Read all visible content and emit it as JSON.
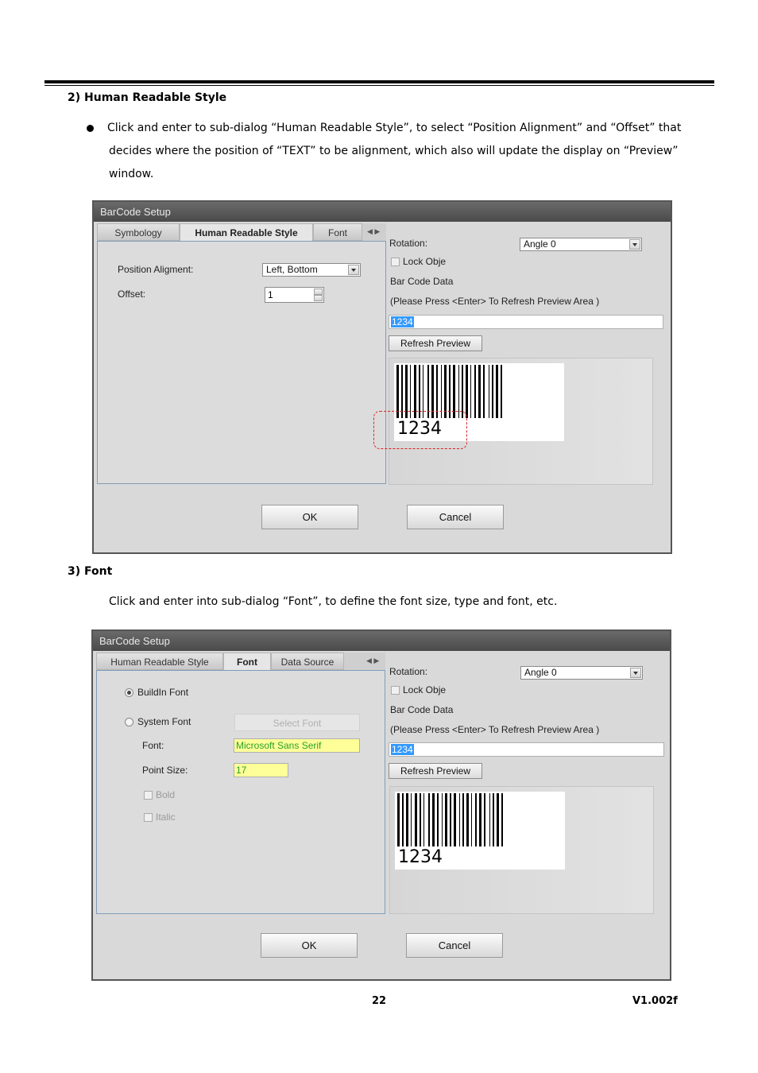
{
  "section2": {
    "heading": "2)   Human Readable Style",
    "bullet_line1": "Click and enter to sub-dialog “Human Readable Style”, to select “Position Alignment” and “Offset” that",
    "bullet_line2": "decides where the position of “TEXT” to be alignment, which also will update the display on “Preview”",
    "bullet_line3": "window."
  },
  "dialog1": {
    "title": "BarCode Setup",
    "tabs": [
      "Symbology",
      "Human Readable Style",
      "Font"
    ],
    "position_alignment_label": "Position Aligment:",
    "position_alignment_value": "Left, Bottom",
    "offset_label": "Offset:",
    "offset_value": "1",
    "rotation_label": "Rotation:",
    "rotation_value": "Angle 0",
    "lock_label": "Lock Obje",
    "barcode_data_label": "Bar Code Data",
    "hint": "(Please  Press <Enter> To Refresh Preview Area )",
    "data_value": "1234",
    "refresh_button": "Refresh Preview",
    "preview_text": "1234",
    "ok_button": "OK",
    "cancel_button": "Cancel"
  },
  "section3": {
    "heading": "3)   Font",
    "paragraph": "Click and enter into sub-dialog “Font”, to define the font size, type and font, etc."
  },
  "dialog2": {
    "title": "BarCode Setup",
    "tabs": [
      "Human Readable Style",
      "Font",
      "Data Source"
    ],
    "buildin_font_label": "BuildIn Font",
    "system_font_label": "System Font",
    "select_font_button": "Select Font",
    "font_label": "Font:",
    "font_value": "Microsoft Sans Serif",
    "point_size_label": "Point Size:",
    "point_size_value": "17",
    "bold_label": "Bold",
    "italic_label": "Italic",
    "rotation_label": "Rotation:",
    "rotation_value": "Angle 0",
    "lock_label": "Lock Obje",
    "barcode_data_label": "Bar Code Data",
    "hint": "(Please  Press <Enter> To Refresh Preview Area )",
    "data_value": "1234",
    "refresh_button": "Refresh Preview",
    "preview_text": "1234",
    "ok_button": "OK",
    "cancel_button": "Cancel"
  },
  "footer": {
    "page_number": "22",
    "version": "V1.002f"
  }
}
